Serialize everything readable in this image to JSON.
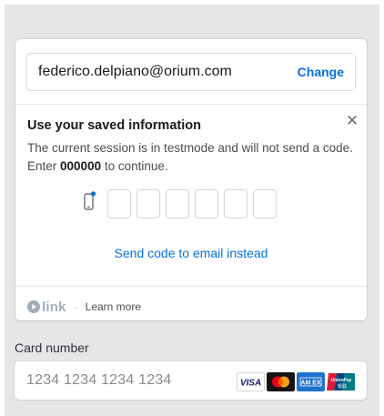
{
  "link": {
    "email": "federico.delpiano@orium.com",
    "change_label": "Change",
    "title": "Use your saved information",
    "description_pre": "The current session is in testmode and will not send a code. Enter ",
    "test_code": "000000",
    "description_post": " to continue.",
    "otp_box_count": 6,
    "send_code_label": "Send code to email instead",
    "brand_label": "link",
    "separator": "·",
    "learn_more_label": "Learn more"
  },
  "card": {
    "label": "Card number",
    "placeholder": "1234 1234 1234 1234",
    "brands": [
      "visa-icon",
      "mastercard-icon",
      "amex-icon",
      "unionpay-icon"
    ]
  },
  "colors": {
    "accent": "#0570de",
    "background": "#e6e6e6",
    "muted": "#a3acb9"
  }
}
